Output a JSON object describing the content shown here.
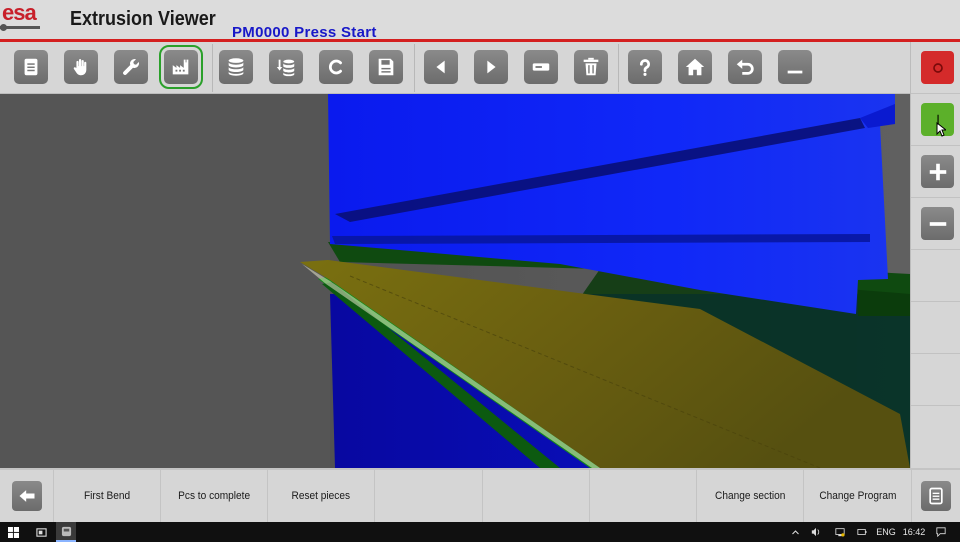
{
  "header": {
    "logo_text": "esa",
    "app_title": "Extrusion Viewer",
    "status_message": "PM0000 Press Start"
  },
  "toolbar": {
    "buttons": [
      {
        "id": "document",
        "icon": "document-icon"
      },
      {
        "id": "manual",
        "icon": "hand-icon"
      },
      {
        "id": "tools",
        "icon": "wrench-icon"
      },
      {
        "id": "factory",
        "icon": "factory-icon",
        "active": true
      },
      {
        "id": "database",
        "icon": "database-icon"
      },
      {
        "id": "database-download",
        "icon": "database-download-icon"
      },
      {
        "id": "clear",
        "icon": "c-letter-icon"
      },
      {
        "id": "save",
        "icon": "floppy-icon"
      },
      {
        "id": "previous",
        "icon": "arrow-left-icon"
      },
      {
        "id": "next",
        "icon": "arrow-right-icon"
      },
      {
        "id": "minus-field",
        "icon": "minus-box-icon"
      },
      {
        "id": "delete",
        "icon": "trash-icon"
      },
      {
        "id": "help",
        "icon": "question-icon"
      },
      {
        "id": "home",
        "icon": "home-icon"
      },
      {
        "id": "undo",
        "icon": "undo-icon"
      },
      {
        "id": "minimize",
        "icon": "minimize-icon"
      }
    ]
  },
  "right_panel": {
    "stop_color": "#d42a2a",
    "start_color": "#5cb02a",
    "buttons": [
      "stop-icon",
      "start-icon",
      "zoom-in-icon",
      "zoom-out-icon"
    ]
  },
  "bottom_bar": {
    "softkeys": [
      {
        "id": "back",
        "label": ""
      },
      {
        "id": "first-bend",
        "label": "First Bend"
      },
      {
        "id": "pcs-to-complete",
        "label": "Pcs to complete"
      },
      {
        "id": "reset-pieces",
        "label": "Reset pieces"
      },
      {
        "id": "empty-1",
        "label": ""
      },
      {
        "id": "empty-2",
        "label": ""
      },
      {
        "id": "empty-3",
        "label": ""
      },
      {
        "id": "change-section",
        "label": "Change section"
      },
      {
        "id": "change-program",
        "label": "Change Program"
      },
      {
        "id": "list",
        "label": ""
      }
    ]
  },
  "taskbar": {
    "language": "ENG",
    "time": "16:42"
  },
  "colors": {
    "accent_red": "#d42020",
    "status_blue": "#1818c8",
    "tool_blue": "#0a1aee",
    "sheet_yellow": "#6d6410",
    "die_green": "#0f5a14"
  }
}
